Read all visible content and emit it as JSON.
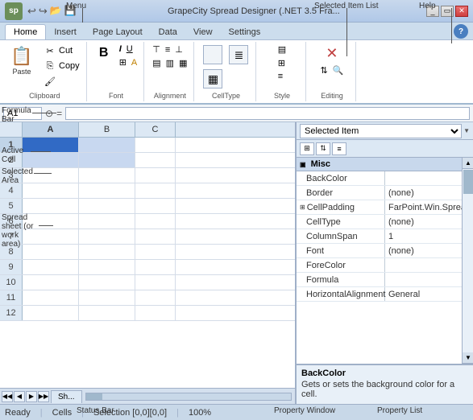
{
  "window": {
    "title": "GrapeCity Spread Designer (.NET 3.5 Fra...",
    "logo": "sp"
  },
  "ribbon": {
    "tabs": [
      "Home",
      "Insert",
      "Page Layout",
      "Data",
      "View",
      "Settings"
    ],
    "active_tab": "Home",
    "groups": [
      {
        "label": "Clipboard",
        "items": [
          "Cut",
          "Copy",
          "Paste"
        ]
      },
      {
        "label": "Font",
        "items": [
          "Bold"
        ]
      },
      {
        "label": "Alignment"
      },
      {
        "label": "CellType"
      },
      {
        "label": "Style"
      },
      {
        "label": "Editing"
      }
    ],
    "help": "?"
  },
  "formula_bar": {
    "cell_ref": "A1",
    "formula": ""
  },
  "annotations": {
    "menu": "Menu",
    "formula_bar": "Formula\nBar",
    "active_cell": "Active\nCell",
    "selected_area": "Selected\nArea",
    "spreadsheet": "Spread sheet (or\nwork area)",
    "status_bar": "Status Bar",
    "selected_item_list": "Selected Item List",
    "property_window": "Property Window",
    "property_list": "Property List",
    "help": "Help"
  },
  "grid": {
    "columns": [
      "A",
      "B",
      "C"
    ],
    "rows": [
      "1",
      "2",
      "3",
      "4",
      "5",
      "6",
      "7",
      "8",
      "9",
      "10",
      "11",
      "12"
    ]
  },
  "sheet_tabs": [
    "Sh..."
  ],
  "right_panel": {
    "selected_item": "Selected Item",
    "properties": [
      {
        "section": "Misc",
        "expanded": true
      },
      {
        "name": "BackColor",
        "value": ""
      },
      {
        "name": "Border",
        "value": "(none)"
      },
      {
        "name": "CellPadding",
        "value": "FarPoint.Win.Spread.CellPad",
        "expandable": true
      },
      {
        "name": "CellType",
        "value": "(none)"
      },
      {
        "name": "ColumnSpan",
        "value": "1"
      },
      {
        "name": "Font",
        "value": "(none)"
      },
      {
        "name": "ForeColor",
        "value": ""
      },
      {
        "name": "Formula",
        "value": ""
      },
      {
        "name": "HorizontalAlignment",
        "value": "General"
      }
    ],
    "description": {
      "title": "BackColor",
      "text": "Gets or sets the background color for a cell."
    }
  },
  "status_bar": {
    "ready": "Ready",
    "cells": "Cells",
    "selection": "Selection [0,0][0,0]",
    "zoom": "100%"
  },
  "clipboard_copy": "Clipboard Copy"
}
